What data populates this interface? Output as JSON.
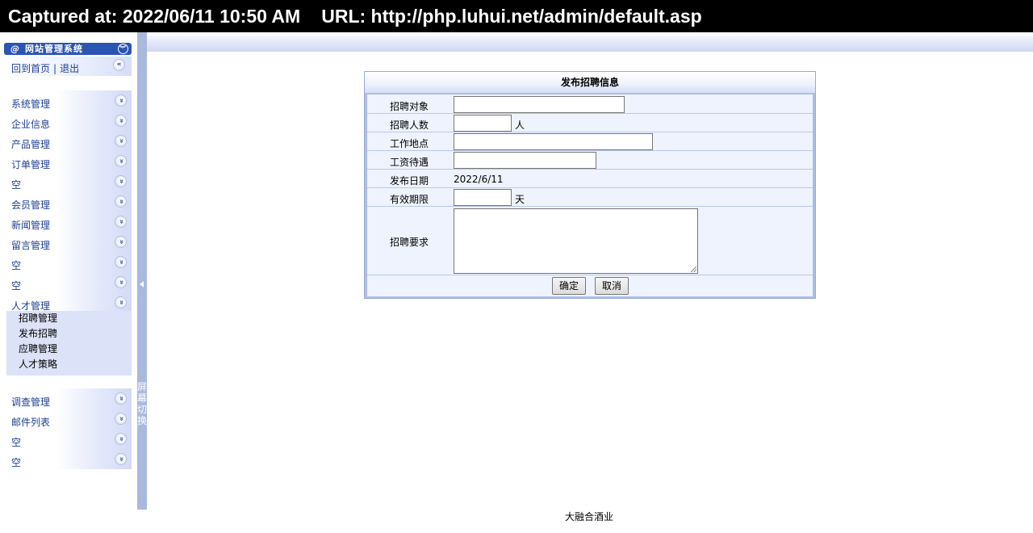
{
  "capture": {
    "captured_at": "Captured at: 2022/06/11 10:50 AM",
    "url": "URL: http://php.luhui.net/admin/default.asp"
  },
  "sidebar": {
    "title": "网站管理系统",
    "home_link": "回到首页",
    "separator": "|",
    "logout_link": "退出",
    "menu_groups_top": [
      {
        "label": "系统管理"
      },
      {
        "label": "企业信息"
      },
      {
        "label": "产品管理"
      },
      {
        "label": "订单管理"
      },
      {
        "label": "空"
      },
      {
        "label": "会员管理"
      },
      {
        "label": "新闻管理"
      },
      {
        "label": "留言管理"
      },
      {
        "label": "空"
      },
      {
        "label": "空"
      },
      {
        "label": "人才管理"
      }
    ],
    "sub_items": [
      {
        "label": "招聘管理"
      },
      {
        "label": "发布招聘"
      },
      {
        "label": "应聘管理"
      },
      {
        "label": "人才策略"
      }
    ],
    "menu_groups_bottom": [
      {
        "label": "调查管理"
      },
      {
        "label": "邮件列表"
      },
      {
        "label": "空"
      },
      {
        "label": "空"
      }
    ],
    "splitter_text": "屏幕切换"
  },
  "form": {
    "title": "发布招聘信息",
    "fields": {
      "target": {
        "label": "招聘对象",
        "value": ""
      },
      "count": {
        "label": "招聘人数",
        "value": "",
        "unit": "人"
      },
      "location": {
        "label": "工作地点",
        "value": ""
      },
      "salary": {
        "label": "工资待遇",
        "value": ""
      },
      "date": {
        "label": "发布日期",
        "value": "2022/6/11"
      },
      "validity": {
        "label": "有效期限",
        "value": "",
        "unit": "天"
      },
      "requirements": {
        "label": "招聘要求",
        "value": ""
      }
    },
    "buttons": {
      "ok": "确定",
      "cancel": "取消"
    }
  },
  "footer": {
    "text": "大融合酒业"
  },
  "colors": {
    "menu_link": "#1f3f95",
    "form_border": "#aebde6",
    "form_bg": "#eef3fd",
    "splitter": "#a9b8dd"
  }
}
